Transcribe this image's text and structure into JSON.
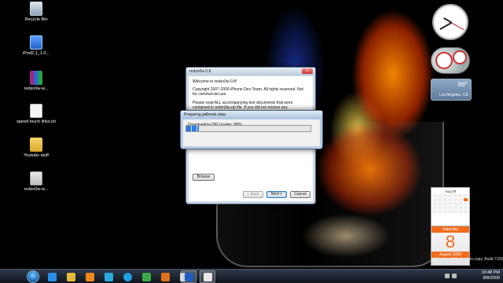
{
  "desktop_icons": [
    {
      "label": "Recycle Bin",
      "icon": "recycle-bin-icon"
    },
    {
      "label": "iPod2,1_1.0...",
      "icon": "ipod-firmware-icon"
    },
    {
      "label": "redsn0w-w...",
      "icon": "winrar-archive-icon"
    },
    {
      "label": "speed touch links.txt",
      "icon": "text-file-icon"
    },
    {
      "label": "Youtube stuff",
      "icon": "folder-icon"
    },
    {
      "label": "redsn0w-w...",
      "icon": "exe-file-icon"
    }
  ],
  "main_window": {
    "title": "redsn0w 0.8",
    "close_label": "x",
    "welcome": "Welcome to redsn0w 0.8!",
    "copyright": "Copyright 2007-2009 iPhone Dev-Team. All rights reserved. Not for commercial use.",
    "notice": "Please read ALL accompanying text documents that were contained in redsn0w.zip file. If you did not receive any accompanying text files, please visit http://blog.iphone-dev.org",
    "browse_label": "Browse",
    "back_label": "< Back",
    "next_label": "Next >",
    "cancel_label": "Cancel"
  },
  "progress_window": {
    "title": "Preparing jailbreak data",
    "status": "Downloading DFU loader: 89%",
    "progress_fraction": 0.1
  },
  "gadgets": {
    "weather_temp": "66°",
    "weather_city": "Los Angeles, CA",
    "calendar_month_header": "Aug 09",
    "calendar_day_name": "Saturday",
    "calendar_day": "8",
    "calendar_month_year": "August 2009"
  },
  "taskbar": {
    "time": "10:48 PM",
    "date": "8/8/2009",
    "build_text": "Windows 7 Evaluation copy. Build 7100",
    "pinned": [
      "ie-icon",
      "explorer-icon",
      "media-player-icon",
      "skype-icon",
      "skype-icon-2",
      "media-icon",
      "winamp-icon",
      "iv-icon",
      "redsn0w-icon",
      "document-icon"
    ]
  }
}
